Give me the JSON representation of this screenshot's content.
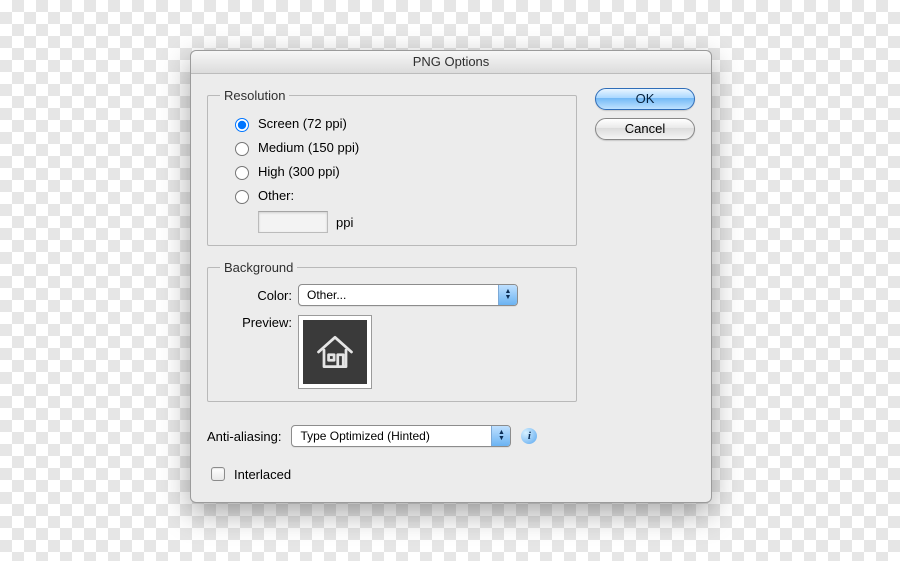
{
  "title": "PNG Options",
  "resolution": {
    "legend": "Resolution",
    "options": {
      "screen": "Screen (72 ppi)",
      "medium": "Medium (150 ppi)",
      "high": "High (300 ppi)",
      "other": "Other:"
    },
    "selected": "screen",
    "ppi_value": "",
    "ppi_unit": "ppi"
  },
  "background": {
    "legend": "Background",
    "color_label": "Color:",
    "color_value": "Other...",
    "preview_label": "Preview:"
  },
  "anti_aliasing": {
    "label": "Anti-aliasing:",
    "value": "Type Optimized (Hinted)"
  },
  "interlaced": {
    "label": "Interlaced",
    "checked": false
  },
  "buttons": {
    "ok": "OK",
    "cancel": "Cancel"
  },
  "select_widths": {
    "color": 218,
    "aa": 218
  }
}
